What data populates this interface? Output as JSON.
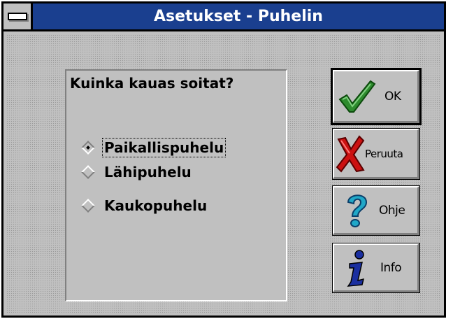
{
  "window": {
    "title": "Asetukset - Puhelin"
  },
  "group": {
    "question": "Kuinka kauas soitat?",
    "options": [
      {
        "label": "Paikallispuhelu",
        "selected": true
      },
      {
        "label": "Lähipuhelu",
        "selected": false
      },
      {
        "label": "Kaukopuhelu",
        "selected": false
      }
    ]
  },
  "buttons": {
    "ok": "OK",
    "cancel": "Peruuta",
    "help": "Ohje",
    "info": "Info"
  },
  "icons": {
    "ok": "green-checkmark-icon",
    "cancel": "red-x-icon",
    "help": "question-mark-icon",
    "info": "info-i-icon"
  },
  "colors": {
    "titlebar": "#1a3f8f",
    "face": "#c0c0c0",
    "check": "#2e8b2e",
    "cross": "#cc1111",
    "question": "#20a8c8",
    "info": "#1a2fa0"
  }
}
